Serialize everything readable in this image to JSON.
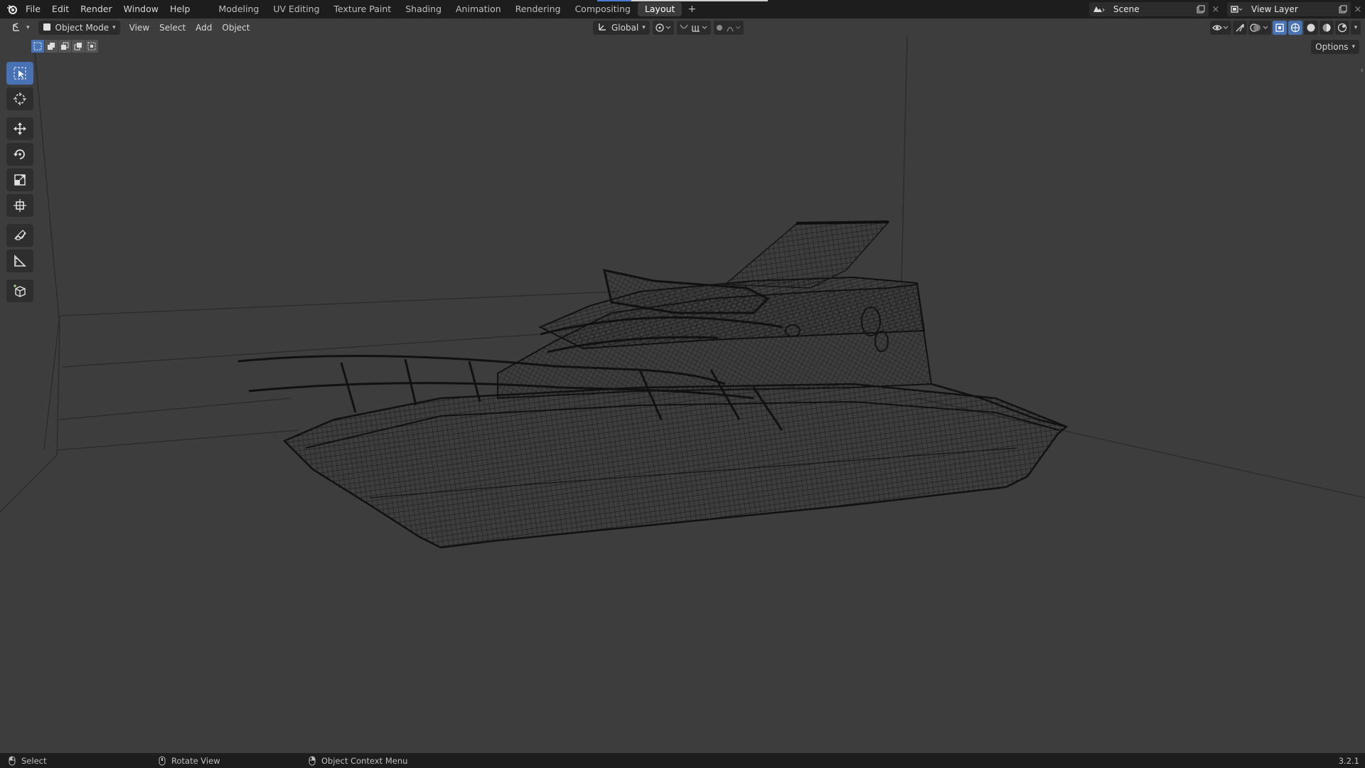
{
  "menubar": {
    "items": [
      "File",
      "Edit",
      "Render",
      "Window",
      "Help"
    ],
    "workspaces": [
      "Modeling",
      "UV Editing",
      "Texture Paint",
      "Shading",
      "Animation",
      "Rendering",
      "Compositing",
      "Layout"
    ],
    "active_workspace": "Layout",
    "add_tab": "+",
    "scene": "Scene",
    "view_layer": "View Layer",
    "close_glyph": "×"
  },
  "viewport_header": {
    "editor_type_icon": "3d-viewport-icon",
    "mode": "Object Mode",
    "menus": [
      "View",
      "Select",
      "Add",
      "Object"
    ],
    "transform_orientation": "Global",
    "options_label": "Options"
  },
  "toolbar": {
    "tools": [
      "select-box-icon",
      "cursor-icon",
      "move-icon",
      "rotate-icon",
      "scale-icon",
      "transform-icon",
      "annotate-icon",
      "measure-icon",
      "add-cube-icon"
    ],
    "active_tool": "select-box-icon"
  },
  "viewport": {
    "shading": "wireframe",
    "object": "boat-wireframe"
  },
  "statusbar": {
    "select_label": "Select",
    "rotate_label": "Rotate View",
    "context_label": "Object Context Menu",
    "version": "3.2.1"
  },
  "colors": {
    "accent": "#4772b3",
    "viewport_bg": "#3d3d3d",
    "bar_bg": "#1d1d1d"
  }
}
